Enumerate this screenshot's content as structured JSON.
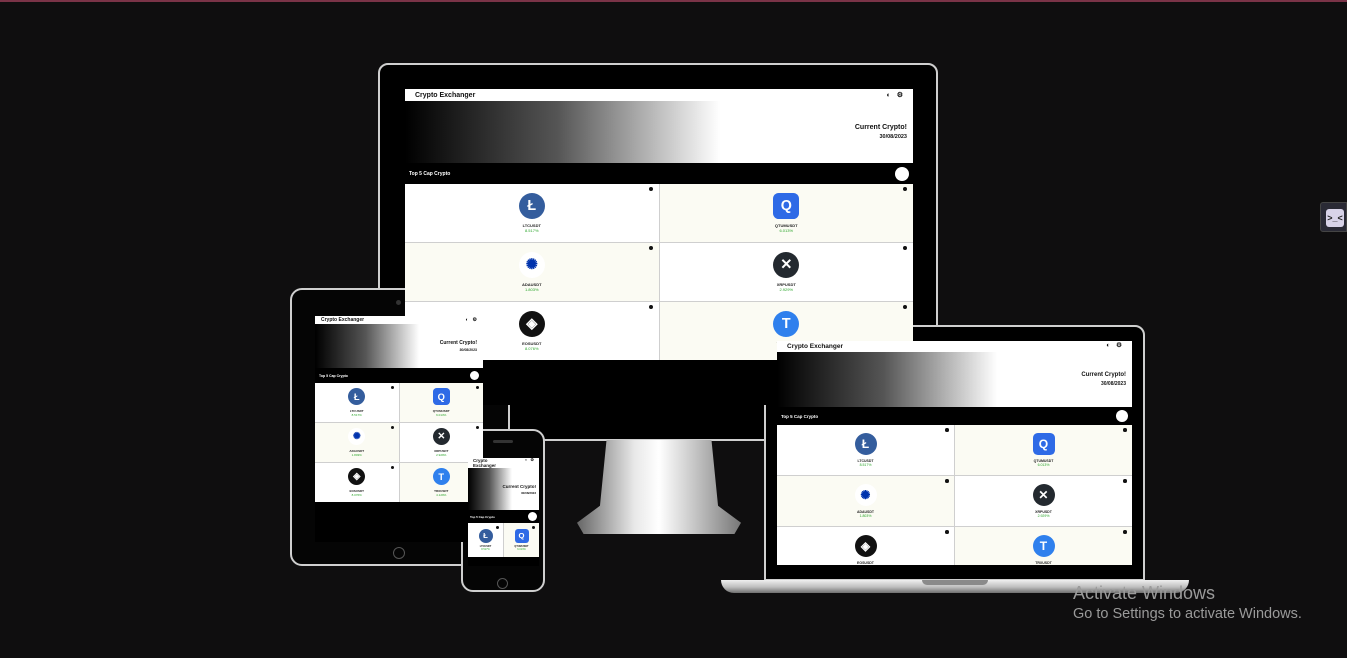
{
  "app": {
    "title": "Crypto Exchanger",
    "hero_title": "Current Crypto!",
    "hero_date": "30/08/2023",
    "section_title": "Top 5 Cap Crypto",
    "icons": [
      "contrast-icon",
      "gear-icon"
    ]
  },
  "coins": [
    {
      "symbol": "LTCUSDT",
      "change": "8.517%",
      "icon": "litecoin-icon"
    },
    {
      "symbol": "QTUMUSDT",
      "change": "6.013%",
      "icon": "qtum-icon"
    },
    {
      "symbol": "ADAUSDT",
      "change": "1.803%",
      "icon": "cardano-icon"
    },
    {
      "symbol": "XRPUSDT",
      "change": "2.929%",
      "icon": "xrp-icon"
    },
    {
      "symbol": "EOSUSDT",
      "change": "8.076%",
      "icon": "eos-icon"
    },
    {
      "symbol": "TRXUSDT",
      "change": "4.129%",
      "icon": "tron-icon"
    }
  ],
  "watermark": {
    "line1": "Activate Windows",
    "line2": "Go to Settings to activate Windows."
  },
  "colors": {
    "background": "#0f0e0f",
    "positive": "#2aa52a",
    "ltc": "#345d9d",
    "qtum": "#2e6ae6",
    "tron": "#2f80ed"
  }
}
